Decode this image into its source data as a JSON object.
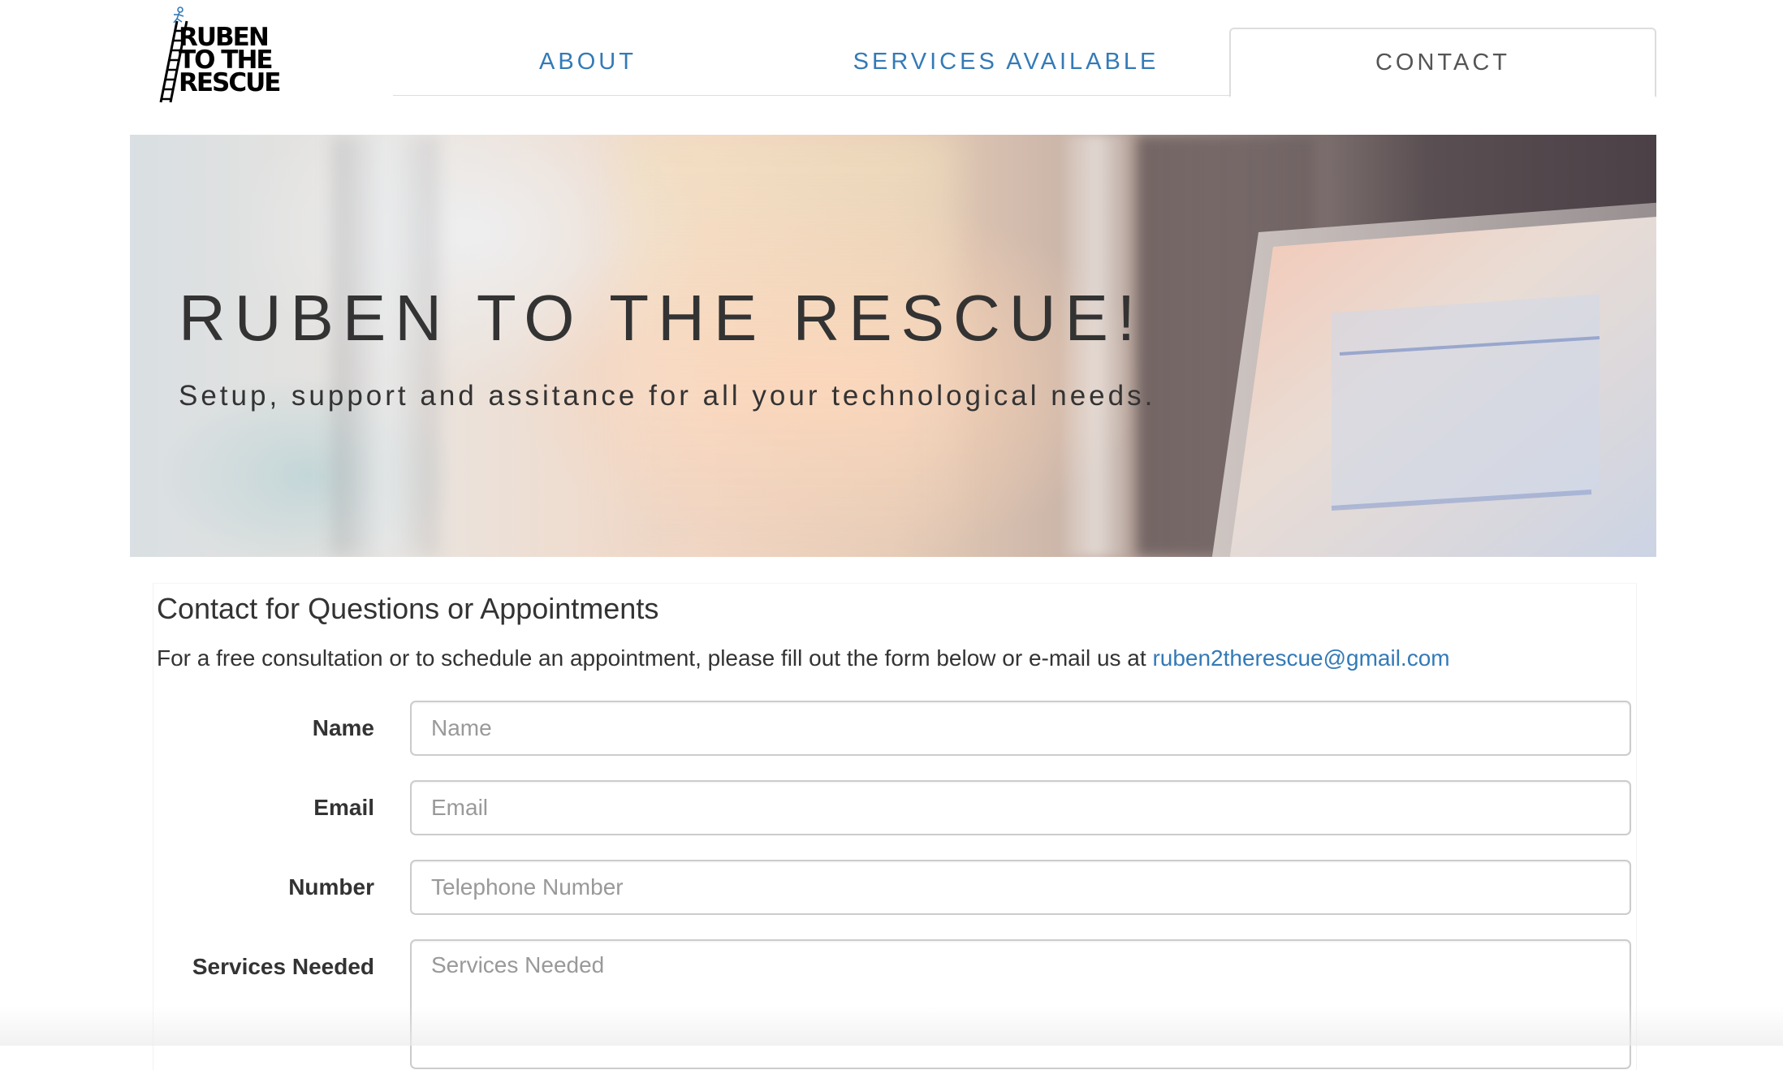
{
  "header": {
    "logo": {
      "lines": [
        "RUBEN",
        "TO THE",
        "RESCUE"
      ],
      "icon": "ladder-climber-icon"
    },
    "nav": [
      {
        "label": "ABOUT",
        "active": false
      },
      {
        "label": "SERVICES AVAILABLE",
        "active": false
      },
      {
        "label": "CONTACT",
        "active": true
      }
    ]
  },
  "hero": {
    "title": "RUBEN TO THE RESCUE!",
    "subtitle": "Setup, support and assitance for all your technological needs."
  },
  "contact": {
    "heading": "Contact for Questions or Appointments",
    "intro_text": "For a free consultation or to schedule an appointment, please fill out the form below or e-mail us at ",
    "email": "ruben2therescue@gmail.com",
    "fields": [
      {
        "label": "Name",
        "placeholder": "Name",
        "value": ""
      },
      {
        "label": "Email",
        "placeholder": "Email",
        "value": ""
      },
      {
        "label": "Number",
        "placeholder": "Telephone Number",
        "value": ""
      },
      {
        "label": "Services Needed",
        "placeholder": "Services Needed",
        "value": ""
      }
    ]
  },
  "colors": {
    "link": "#337ab7",
    "text": "#333333",
    "border": "#cccccc",
    "placeholder": "#999999"
  }
}
